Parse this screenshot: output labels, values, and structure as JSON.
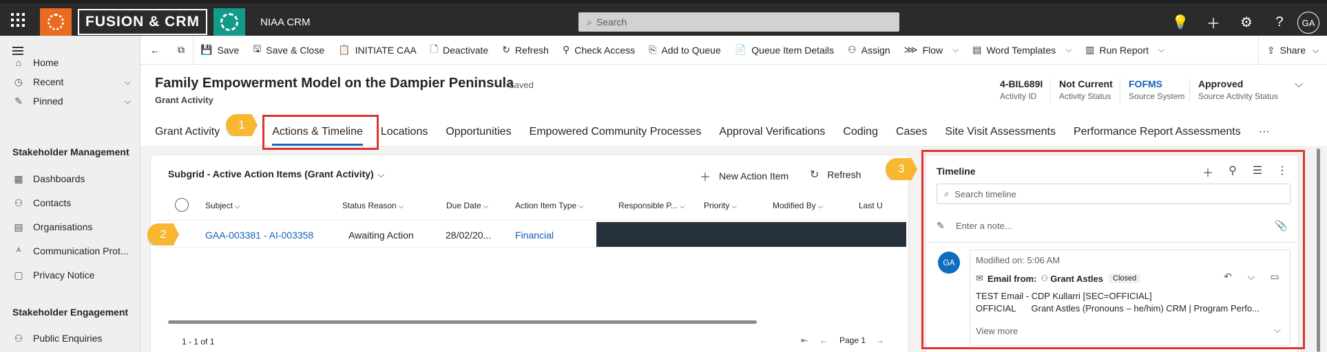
{
  "topbar": {
    "brand": "FUSION & CRM",
    "app_name": "NIAA CRM",
    "search_placeholder": "Search",
    "avatar": "GA"
  },
  "nav": {
    "items": [
      {
        "label": "Home"
      },
      {
        "label": "Recent"
      },
      {
        "label": "Pinned"
      }
    ],
    "groups": [
      {
        "label": "Stakeholder Management",
        "items": [
          "Dashboards",
          "Contacts",
          "Organisations",
          "Communication Prot...",
          "Privacy Notice"
        ]
      },
      {
        "label": "Stakeholder Engagement",
        "items": [
          "Public Enquiries"
        ]
      }
    ]
  },
  "commands": {
    "save": "Save",
    "save_close": "Save & Close",
    "initiate_caa": "INITIATE CAA",
    "deactivate": "Deactivate",
    "refresh": "Refresh",
    "check_access": "Check Access",
    "add_to_queue": "Add to Queue",
    "queue_item_details": "Queue Item Details",
    "assign": "Assign",
    "flow": "Flow",
    "word_templates": "Word Templates",
    "run_report": "Run Report",
    "share": "Share"
  },
  "record": {
    "title": "Family Empowerment Model on the Dampier Peninsula",
    "saved": "- Saved",
    "entity": "Grant Activity",
    "fields": [
      {
        "value": "4-BIL689I",
        "label": "Activity ID"
      },
      {
        "value": "Not Current",
        "label": "Activity Status"
      },
      {
        "value": "FOFMS",
        "label": "Source System"
      },
      {
        "value": "Approved",
        "label": "Source Activity Status"
      }
    ]
  },
  "tabs": [
    "Grant Activity",
    "Actions & Timeline",
    "Locations",
    "Opportunities",
    "Empowered Community Processes",
    "Approval Verifications",
    "Coding",
    "Cases",
    "Site Visit Assessments",
    "Performance Report Assessments",
    "···"
  ],
  "subgrid": {
    "title": "Subgrid - Active Action Items (Grant Activity)",
    "new_item": "New Action Item",
    "refresh": "Refresh",
    "columns": [
      "Subject",
      "Status Reason",
      "Due Date",
      "Action Item Type",
      "Responsible P...",
      "Priority",
      "Modified By",
      "Last U"
    ],
    "rows": [
      {
        "subject": "GAA-003381 - AI-003358",
        "status": "Awaiting Action",
        "due": "28/02/20...",
        "type": "Financial"
      }
    ],
    "count": "1 - 1 of 1",
    "page": "Page 1"
  },
  "timeline": {
    "title": "Timeline",
    "search_placeholder": "Search timeline",
    "note_placeholder": "Enter a note...",
    "post": {
      "avatar": "GA",
      "modified": "Modified on: 5:06 AM",
      "email_from": "Email from:",
      "sender": "Grant Astles",
      "badge": "Closed",
      "line1": "TEST Email - CDP Kullarri [SEC=OFFICIAL]",
      "line2a": "OFFICIAL",
      "line2b": "Grant Astles (Pronouns – he/him) CRM | Program Perfo...",
      "view_more": "View more"
    }
  },
  "annotations": [
    "1",
    "2",
    "3"
  ],
  "colors": {
    "accent": "#0f6cbd",
    "annotation": "#f7b731",
    "highlight": "#e03131"
  }
}
